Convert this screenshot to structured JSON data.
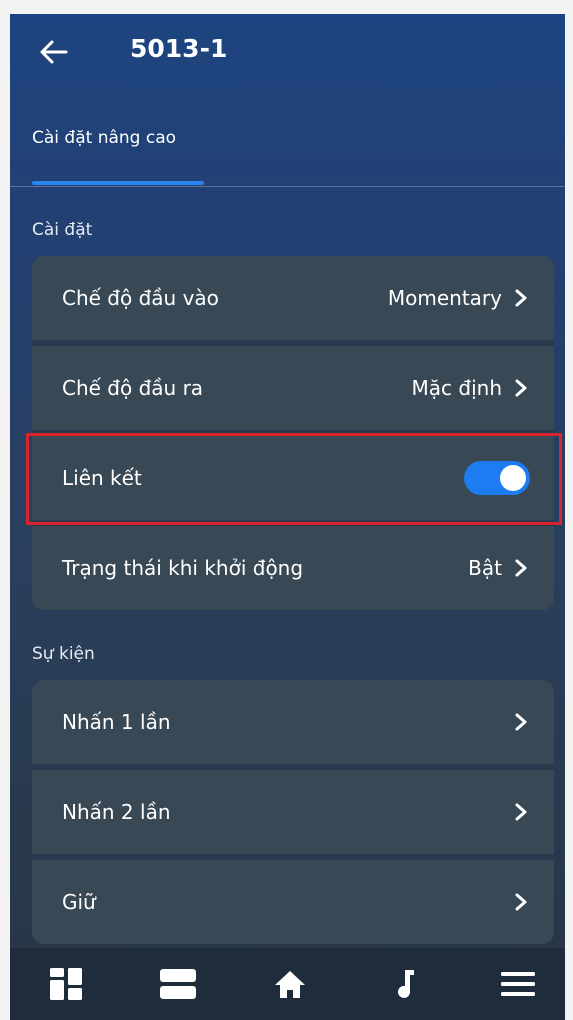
{
  "header": {
    "title": "5013-1",
    "back_icon": "arrow-left-icon"
  },
  "tabs": [
    {
      "label": "Cài đặt nâng cao",
      "active": true
    }
  ],
  "sections": {
    "settings": {
      "title": "Cài đặt",
      "rows": [
        {
          "label": "Chế độ đầu vào",
          "value": "Momentary"
        },
        {
          "label": "Chế độ đầu ra",
          "value": "Mặc định"
        },
        {
          "label": "Liên kết",
          "toggle_on": true
        },
        {
          "label": "Trạng thái khi khởi động",
          "value": "Bật"
        }
      ]
    },
    "events": {
      "title": "Sự kiện",
      "rows": [
        {
          "label": "Nhấn 1 lần"
        },
        {
          "label": "Nhấn 2 lần"
        },
        {
          "label": "Giữ"
        }
      ]
    }
  },
  "bottom_nav": [
    "dashboard-icon",
    "rooms-icon",
    "home-icon",
    "music-icon",
    "menu-icon"
  ],
  "colors": {
    "accent": "#1e7cf2",
    "highlight": "#d8242c",
    "card": "#394855"
  }
}
